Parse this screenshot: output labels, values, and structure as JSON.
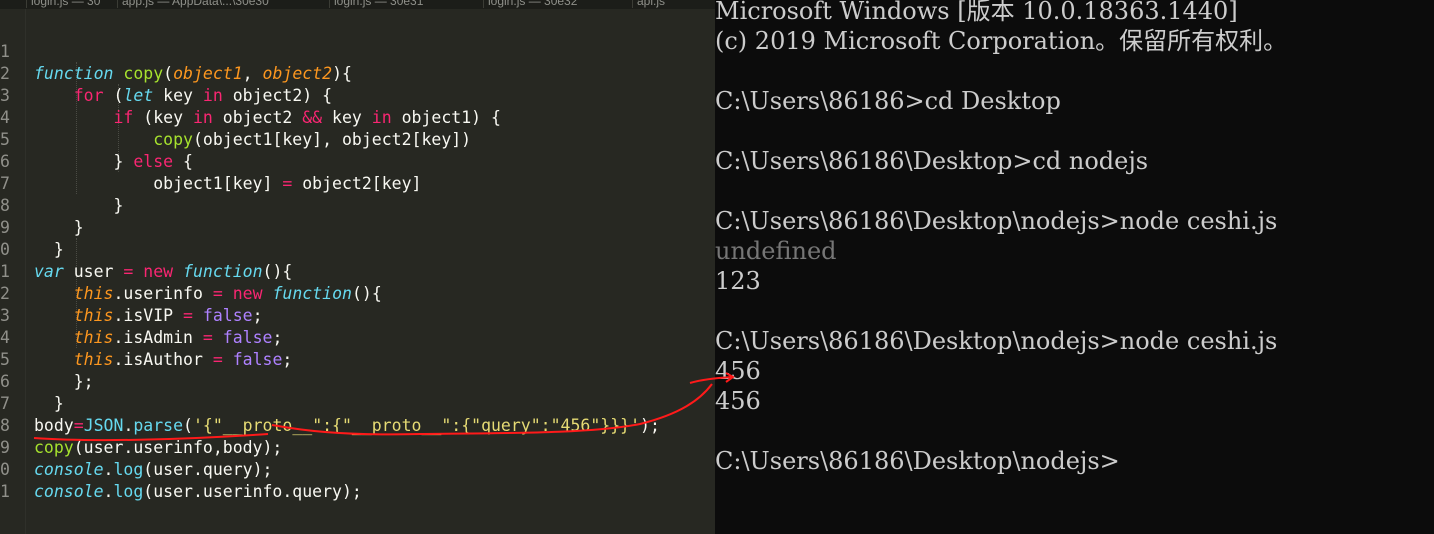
{
  "editor": {
    "tabs": [
      {
        "label": "login.js — 30"
      },
      {
        "label": "app.js — AppData\\...\\30e30"
      },
      {
        "label": "login.js — 30e31"
      },
      {
        "label": "login.js — 30e32"
      },
      {
        "label": "api.js"
      }
    ],
    "line_numbers": [
      "1",
      "2",
      "3",
      "4",
      "5",
      "6",
      "7",
      "8",
      "9",
      "0",
      "1",
      "2",
      "3",
      "4",
      "5",
      "6",
      "7",
      "8",
      "9",
      "0",
      "1"
    ],
    "lines": [
      "function copy(object1, object2){",
      "    for (let key in object2) {",
      "        if (key in object2 && key in object1) {",
      "            copy(object1[key], object2[key])",
      "        } else {",
      "            object1[key] = object2[key]",
      "        }",
      "    }",
      "  }",
      "var user = new function(){",
      "    this.userinfo = new function(){",
      "    this.isVIP = false;",
      "    this.isAdmin = false;",
      "    this.isAuthor = false;",
      "    };",
      "  }",
      "body=JSON.parse('{\"__proto__\":{\"__proto__\":{\"query\":\"456\"}}}');",
      "copy(user.userinfo,body);",
      "console.log(user.query);",
      "console.log(user.userinfo.query);",
      ""
    ],
    "colors": {
      "background": "#272822",
      "keyword": "#f92672",
      "function": "#a6e22e",
      "string": "#e6db74",
      "constant": "#ae81ff",
      "storage": "#66d9ef",
      "param": "#fd971f"
    }
  },
  "terminal": {
    "lines": [
      "Microsoft Windows [版本 10.0.18363.1440]",
      "(c) 2019 Microsoft Corporation。保留所有权利。",
      "",
      "C:\\Users\\86186>cd Desktop",
      "",
      "C:\\Users\\86186\\Desktop>cd nodejs",
      "",
      "C:\\Users\\86186\\Desktop\\nodejs>node ceshi.js",
      "undefined",
      "123",
      "",
      "C:\\Users\\86186\\Desktop\\nodejs>node ceshi.js",
      "456",
      "456",
      "",
      "C:\\Users\\86186\\Desktop\\nodejs>"
    ],
    "colors": {
      "background": "#0c0c0c",
      "text": "#cccccc"
    }
  },
  "annotation": {
    "color": "#ff1a1a"
  }
}
